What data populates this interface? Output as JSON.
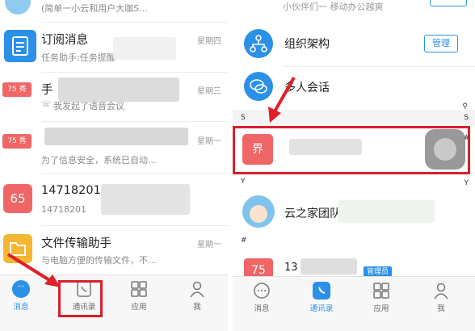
{
  "left": {
    "top_cut_text": "(简单一小云和用户大咖S...",
    "rows": [
      {
        "title": "订阅消息",
        "sub": "任务助手:任务提醒",
        "day": "星期四",
        "icon": "document-icon",
        "color": "#2b90e8"
      },
      {
        "title": "手",
        "sub": "我发起了语音会议",
        "day": "星期三",
        "badge": "75",
        "badge2": "秀"
      },
      {
        "title": "",
        "sub": "为了信息安全，系统已自动...",
        "day": "星期一",
        "badge": "75",
        "badge2": "秀"
      },
      {
        "title": "14718201",
        "sub": "14718201",
        "day": "",
        "avatar_text": "65"
      },
      {
        "title": "文件传输助手",
        "sub": "与电脑方便的传输文件，不...",
        "day": "星期一",
        "icon": "folder-icon",
        "color": "#f5b731"
      }
    ],
    "tabs": [
      "消息",
      "通讯录",
      "应用",
      "我"
    ]
  },
  "right": {
    "top_cut_text": "小伙伴们一 移动办公越爽",
    "org_label": "组织架构",
    "manage_label": "管理",
    "multi_chat_label": "多人会话",
    "index_s": "S",
    "index_s2": "S",
    "index_hash": "#",
    "index_y": "Y",
    "index_y_right": "Y",
    "index_hash_section": "#",
    "highlight_char": "界",
    "team_label": "云之家团队",
    "last_contact_prefix": "13",
    "last_avatar": "75",
    "admin_tag": "管理员",
    "tabs": [
      "消息",
      "通讯录",
      "应用",
      "我"
    ]
  },
  "colors": {
    "accent": "#2b90e8",
    "highlight": "#d6202c",
    "badge": "#f06666"
  }
}
